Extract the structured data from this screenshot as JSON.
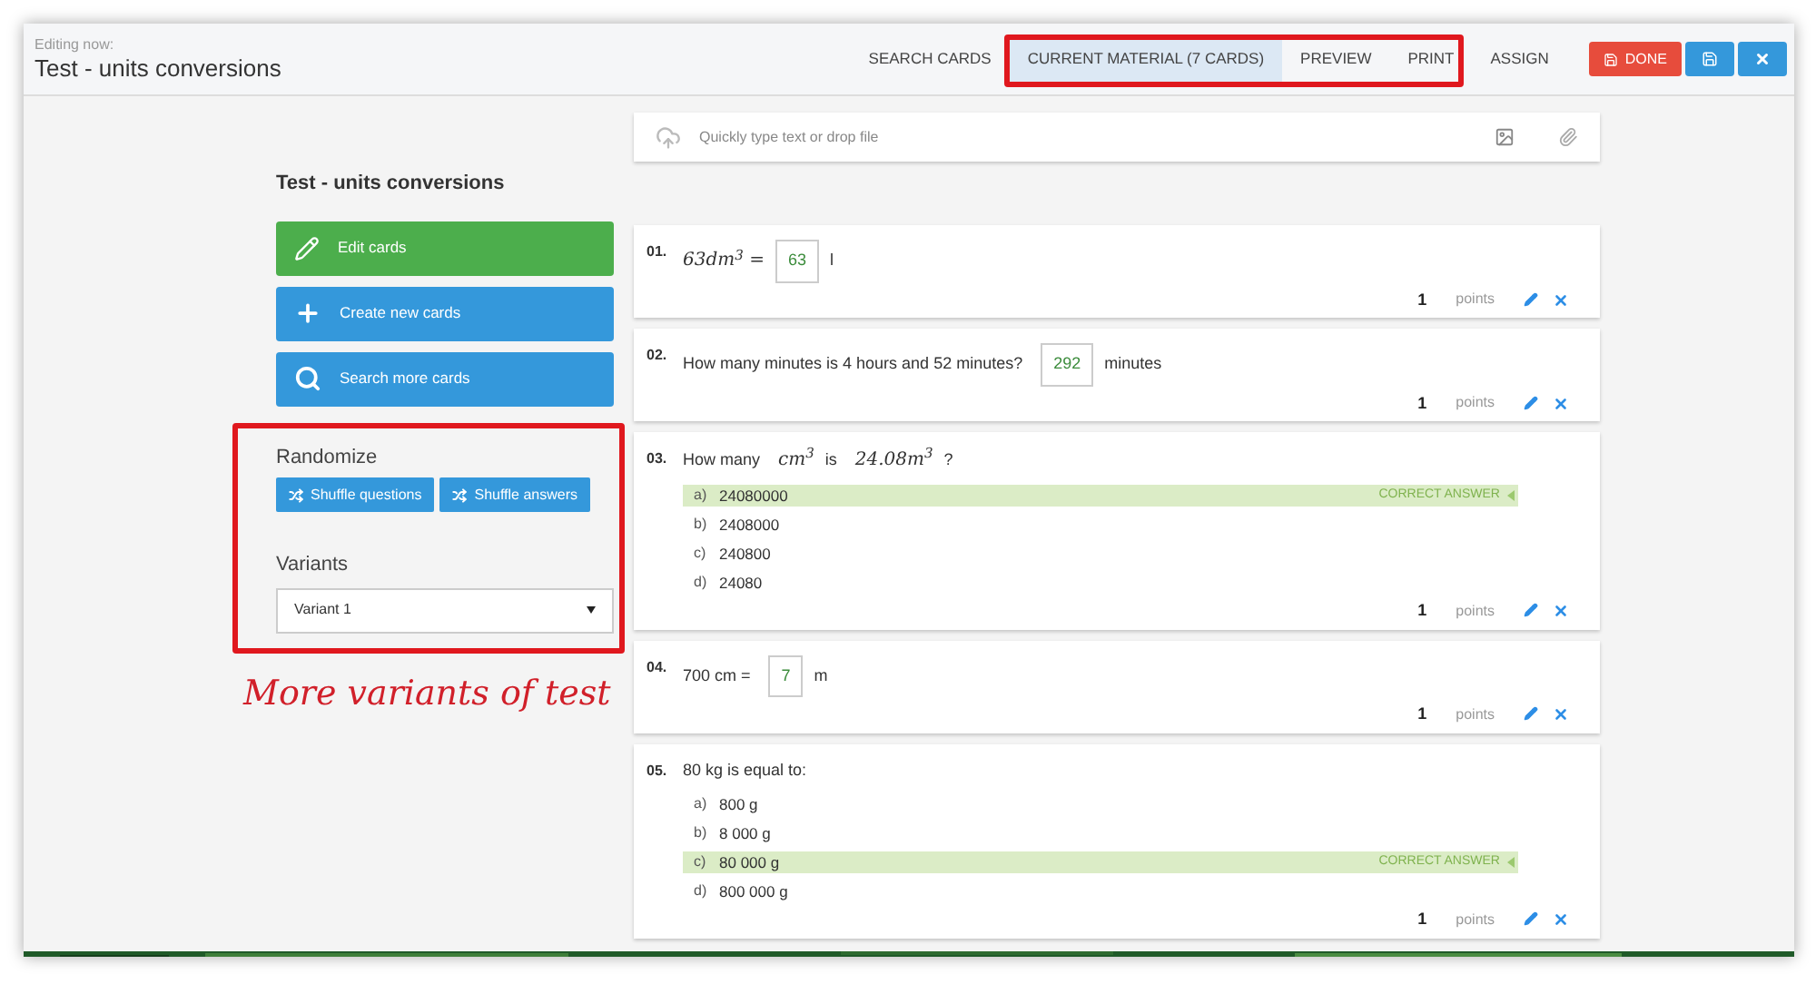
{
  "header": {
    "caption": "Editing now:",
    "title": "Test - units conversions"
  },
  "tabs": [
    {
      "label": "SEARCH CARDS",
      "selected": false
    },
    {
      "label": "CURRENT MATERIAL (7 CARDS)",
      "selected": true
    },
    {
      "label": "PREVIEW",
      "selected": false
    },
    {
      "label": "PRINT",
      "selected": false
    },
    {
      "label": "ASSIGN",
      "selected": false
    }
  ],
  "actions": {
    "done": "DONE"
  },
  "dropzone": {
    "placeholder": "Quickly type text or drop file"
  },
  "sidebar": {
    "title": "Test - units conversions",
    "buttons": [
      {
        "label": "Edit cards",
        "kind": "edit"
      },
      {
        "label": "Create new cards",
        "kind": "create"
      },
      {
        "label": "Search more cards",
        "kind": "search"
      }
    ],
    "randomize": {
      "label": "Randomize",
      "buttons": [
        "Shuffle questions",
        "Shuffle answers"
      ]
    },
    "variants": {
      "label": "Variants",
      "value": "Variant 1"
    }
  },
  "questions": [
    {
      "number": "01.",
      "kind": "fill",
      "parts": [
        {
          "kind": "math",
          "text": "63dm$^{3}$ ="
        },
        {
          "kind": "blank",
          "value": "63"
        },
        {
          "kind": "text",
          "text": "l"
        }
      ],
      "points": "1",
      "points_label": "points"
    },
    {
      "number": "02.",
      "kind": "fill",
      "parts": [
        {
          "kind": "text",
          "text": "How many minutes is 4 hours and 52 minutes?"
        },
        {
          "kind": "blank",
          "value": "292"
        },
        {
          "kind": "text",
          "text": "minutes"
        }
      ],
      "points": "1",
      "points_label": "points"
    },
    {
      "number": "03.",
      "kind": "choice",
      "parts": [
        {
          "kind": "text",
          "text": "How many"
        },
        {
          "kind": "math",
          "text": "cm$^{3}$"
        },
        {
          "kind": "text",
          "text": "is"
        },
        {
          "kind": "math",
          "text": "24.08m$^{3}$"
        },
        {
          "kind": "text",
          "text": "?"
        }
      ],
      "correct_label": "CORRECT ANSWER",
      "options": [
        {
          "letter": "a)",
          "text": "24080000",
          "correct": true
        },
        {
          "letter": "b)",
          "text": "2408000",
          "correct": false
        },
        {
          "letter": "c)",
          "text": "240800",
          "correct": false
        },
        {
          "letter": "d)",
          "text": "24080",
          "correct": false
        }
      ],
      "points": "1",
      "points_label": "points"
    },
    {
      "number": "04.",
      "kind": "fill",
      "parts": [
        {
          "kind": "text",
          "text": "700 cm ="
        },
        {
          "kind": "blank",
          "value": "7"
        },
        {
          "kind": "text",
          "text": "m"
        }
      ],
      "points": "1",
      "points_label": "points"
    },
    {
      "number": "05.",
      "kind": "choice",
      "parts": [
        {
          "kind": "text",
          "text": "80 kg is equal to:"
        }
      ],
      "correct_label": "CORRECT ANSWER",
      "options": [
        {
          "letter": "a)",
          "text": "800 g",
          "correct": false
        },
        {
          "letter": "b)",
          "text": "8 000 g",
          "correct": false
        },
        {
          "letter": "c)",
          "text": "80 000 g",
          "correct": true
        },
        {
          "letter": "d)",
          "text": "800 000 g",
          "correct": false
        }
      ],
      "points": "1",
      "points_label": "points"
    }
  ],
  "annotation": {
    "text": "More variants of test"
  }
}
